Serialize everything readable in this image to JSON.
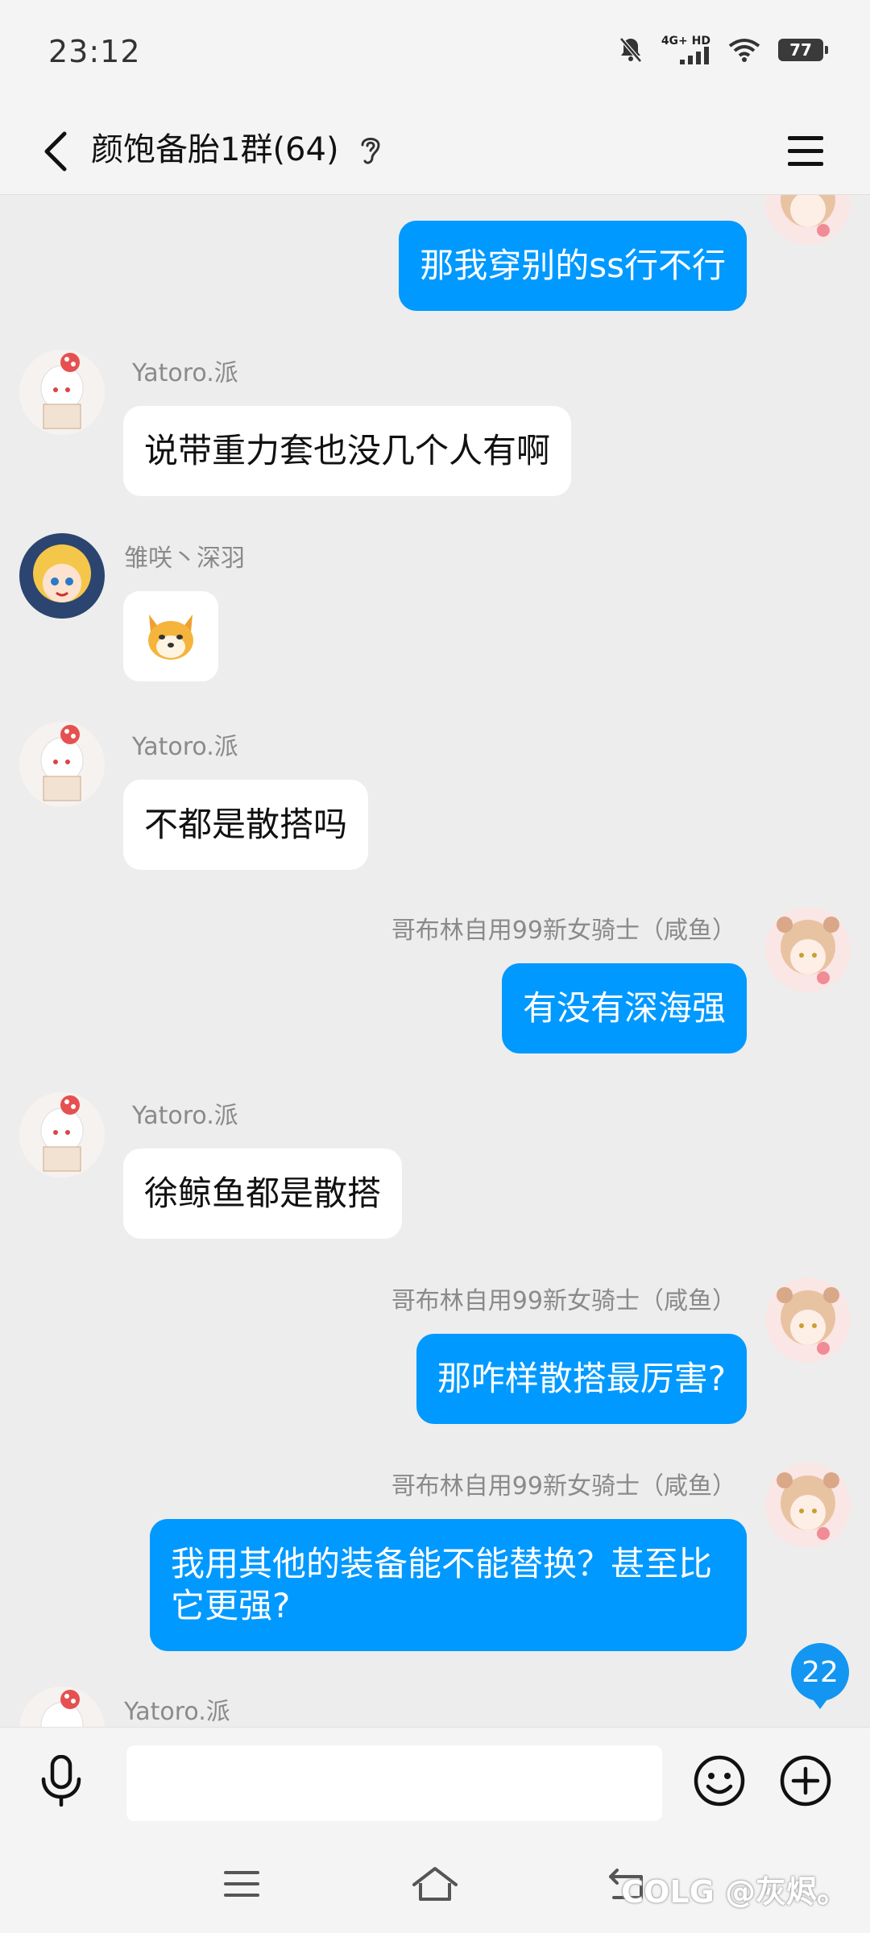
{
  "status_bar": {
    "time": "23:12",
    "network": "4G+ HD",
    "battery": "77"
  },
  "header": {
    "title": "颜饱备胎1群(64)"
  },
  "messages": [
    {
      "side": "out",
      "sender": "",
      "text": "那我穿别的ss行不行"
    },
    {
      "side": "in",
      "sender": "Yatoro.派",
      "text": "说带重力套也没几个人有啊"
    },
    {
      "side": "in",
      "sender": "雏咲丶深羽",
      "text": "",
      "sticker": "shiba-dog-sticker"
    },
    {
      "side": "in",
      "sender": "Yatoro.派",
      "text": "不都是散搭吗"
    },
    {
      "side": "out",
      "sender": "哥布林自用99新女骑士（咸鱼）",
      "text": "有没有深海强"
    },
    {
      "side": "in",
      "sender": "Yatoro.派",
      "text": "徐鲸鱼都是散搭"
    },
    {
      "side": "out",
      "sender": "哥布林自用99新女骑士（咸鱼）",
      "text": "那咋样散搭最厉害?"
    },
    {
      "side": "out",
      "sender": "哥布林自用99新女骑士（咸鱼）",
      "text": "我用其他的装备能不能替换？甚至比它更强?"
    },
    {
      "side": "in",
      "sender": "Yatoro.派",
      "text": ""
    }
  ],
  "unread_count": "22",
  "input": {
    "value": "",
    "placeholder": ""
  },
  "watermark": "COLG @灰烬。",
  "colors": {
    "out_bubble": "#0099ff",
    "in_bubble": "#ffffff",
    "background": "#ededed",
    "badge": "#1296f2"
  },
  "icons": {
    "back": "back-arrow-icon",
    "ear": "ear-icon",
    "menu": "hamburger-menu-icon",
    "mic": "microphone-icon",
    "emoji": "smiley-icon",
    "plus": "plus-circle-icon",
    "nav_menu": "nav-menu-icon",
    "nav_home": "nav-home-icon",
    "nav_back": "nav-back-icon"
  }
}
